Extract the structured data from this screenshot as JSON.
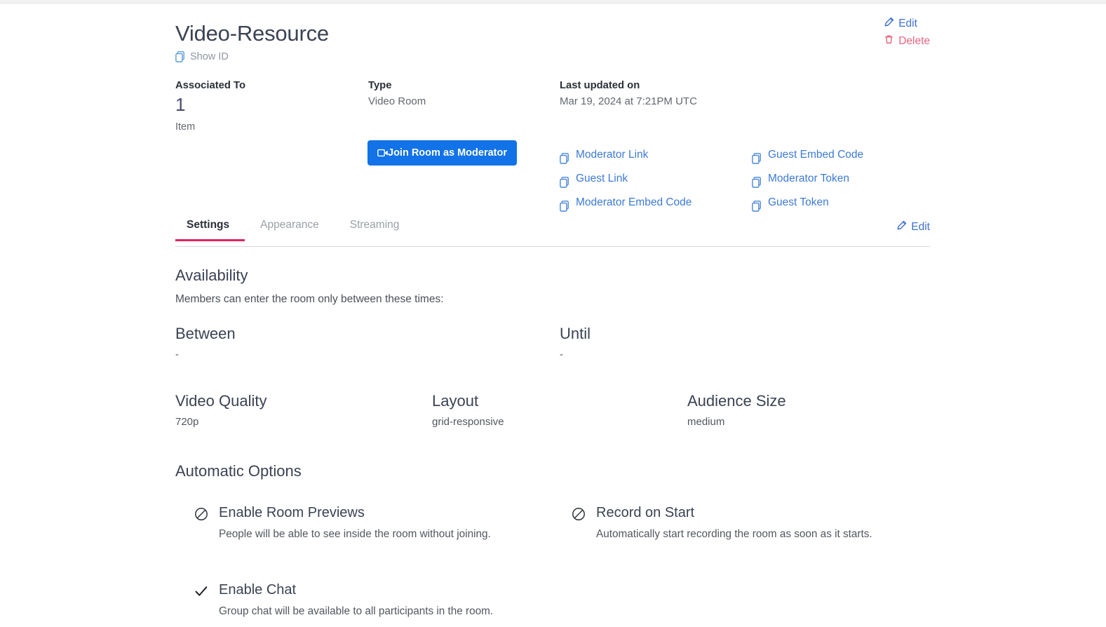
{
  "header": {
    "title": "Video-Resource",
    "show_id_label": "Show ID",
    "show_id_icon": "copy-icon",
    "edit_label": "Edit",
    "edit_icon": "pencil-icon",
    "delete_label": "Delete",
    "delete_icon": "trash-icon",
    "edit_color": "#3d6fd0",
    "delete_color": "#e8657f"
  },
  "meta": {
    "associated": {
      "label": "Associated To",
      "count": "1",
      "unit": "Item"
    },
    "type": {
      "label": "Type",
      "value": "Video Room"
    },
    "updated": {
      "label": "Last updated on",
      "value": "Mar 19, 2024 at 7:21PM UTC"
    }
  },
  "join": {
    "button_label": "Join Room as Moderator",
    "button_icon": "video-camera-icon",
    "button_color": "#1272e8",
    "links_column_a": [
      {
        "label": "Moderator Link",
        "icon": "copy-icon"
      },
      {
        "label": "Guest Link",
        "icon": "copy-icon"
      },
      {
        "label": "Moderator Embed Code",
        "icon": "copy-icon"
      }
    ],
    "links_column_b": [
      {
        "label": "Guest Embed Code",
        "icon": "copy-icon"
      },
      {
        "label": "Moderator Token",
        "icon": "copy-icon"
      },
      {
        "label": "Guest Token",
        "icon": "copy-icon"
      }
    ]
  },
  "tabs": {
    "items": [
      {
        "label": "Settings",
        "active": true
      },
      {
        "label": "Appearance",
        "active": false
      },
      {
        "label": "Streaming",
        "active": false
      }
    ],
    "active_underline_color": "#e0245e",
    "edit_label": "Edit",
    "edit_icon": "pencil-icon"
  },
  "availability": {
    "title": "Availability",
    "subtitle": "Members can enter the room only between these times:",
    "between": {
      "label": "Between",
      "value": "-"
    },
    "until": {
      "label": "Until",
      "value": "-"
    }
  },
  "settings": {
    "video_quality": {
      "label": "Video Quality",
      "value": "720p"
    },
    "layout": {
      "label": "Layout",
      "value": "grid-responsive"
    },
    "audience_size": {
      "label": "Audience Size",
      "value": "medium"
    }
  },
  "automatic_options": {
    "title": "Automatic Options",
    "items": [
      {
        "title": "Enable Room Previews",
        "description": "People will be able to see inside the room without joining.",
        "state": "disabled",
        "icon": "prohibited-icon"
      },
      {
        "title": "Record on Start",
        "description": "Automatically start recording the room as soon as it starts.",
        "state": "disabled",
        "icon": "prohibited-icon"
      },
      {
        "title": "Enable Chat",
        "description": "Group chat will be available to all participants in the room.",
        "state": "enabled",
        "icon": "check-icon"
      }
    ]
  }
}
